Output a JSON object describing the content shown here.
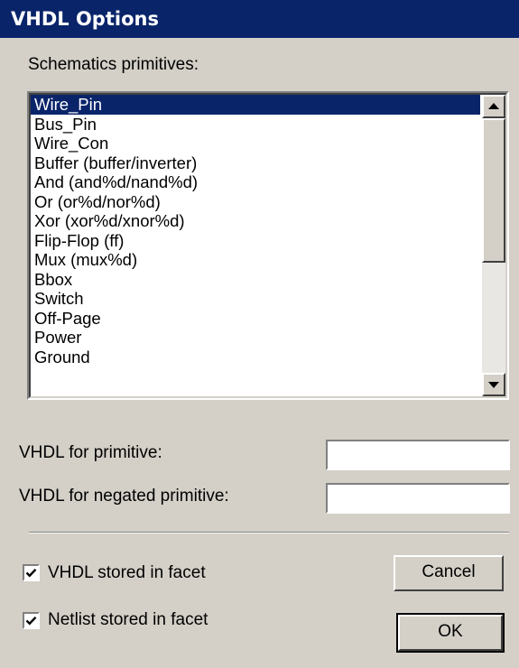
{
  "window": {
    "title": "VHDL Options"
  },
  "list": {
    "label": "Schematics primitives:",
    "items": [
      "Wire_Pin",
      "Bus_Pin",
      "Wire_Con",
      "Buffer (buffer/inverter)",
      "And (and%d/nand%d)",
      "Or (or%d/nor%d)",
      "Xor (xor%d/xnor%d)",
      "Flip-Flop (ff)",
      "Mux (mux%d)",
      "Bbox",
      "Switch",
      "Off-Page",
      "Power",
      "Ground"
    ],
    "selected": "Wire_Pin"
  },
  "fields": {
    "primitive_label": "VHDL for primitive:",
    "primitive_value": "",
    "negated_label": "VHDL for negated primitive:",
    "negated_value": ""
  },
  "options": {
    "vhdl_stored_label": "VHDL stored in facet",
    "vhdl_stored_checked": true,
    "netlist_stored_label": "Netlist stored in facet",
    "netlist_stored_checked": true
  },
  "buttons": {
    "cancel": "Cancel",
    "ok": "OK"
  }
}
